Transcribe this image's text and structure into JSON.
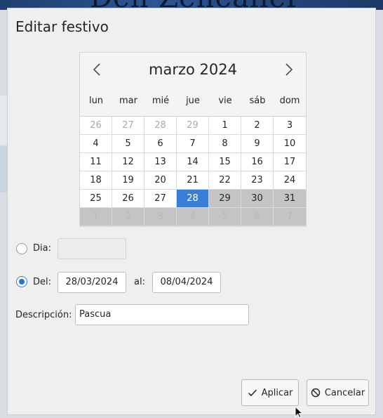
{
  "dialog": {
    "title": "Editar festivo"
  },
  "calendar": {
    "month_label": "marzo 2024",
    "weekdays": [
      "lun",
      "mar",
      "mié",
      "jue",
      "vie",
      "sáb",
      "dom"
    ],
    "weeks": [
      [
        {
          "d": "26",
          "s": "other"
        },
        {
          "d": "27",
          "s": "other"
        },
        {
          "d": "28",
          "s": "other"
        },
        {
          "d": "29",
          "s": "other"
        },
        {
          "d": "1",
          "s": ""
        },
        {
          "d": "2",
          "s": ""
        },
        {
          "d": "3",
          "s": ""
        }
      ],
      [
        {
          "d": "4",
          "s": ""
        },
        {
          "d": "5",
          "s": ""
        },
        {
          "d": "6",
          "s": ""
        },
        {
          "d": "7",
          "s": ""
        },
        {
          "d": "8",
          "s": ""
        },
        {
          "d": "9",
          "s": ""
        },
        {
          "d": "10",
          "s": ""
        }
      ],
      [
        {
          "d": "11",
          "s": ""
        },
        {
          "d": "12",
          "s": ""
        },
        {
          "d": "13",
          "s": ""
        },
        {
          "d": "14",
          "s": ""
        },
        {
          "d": "15",
          "s": ""
        },
        {
          "d": "16",
          "s": ""
        },
        {
          "d": "17",
          "s": ""
        }
      ],
      [
        {
          "d": "18",
          "s": ""
        },
        {
          "d": "19",
          "s": ""
        },
        {
          "d": "20",
          "s": ""
        },
        {
          "d": "21",
          "s": ""
        },
        {
          "d": "22",
          "s": ""
        },
        {
          "d": "23",
          "s": ""
        },
        {
          "d": "24",
          "s": ""
        }
      ],
      [
        {
          "d": "25",
          "s": ""
        },
        {
          "d": "26",
          "s": ""
        },
        {
          "d": "27",
          "s": ""
        },
        {
          "d": "28",
          "s": "sel"
        },
        {
          "d": "29",
          "s": "range"
        },
        {
          "d": "30",
          "s": "range"
        },
        {
          "d": "31",
          "s": "range"
        }
      ],
      [
        {
          "d": "1",
          "s": "hidden"
        },
        {
          "d": "2",
          "s": "hidden"
        },
        {
          "d": "3",
          "s": "hidden"
        },
        {
          "d": "4",
          "s": "hidden"
        },
        {
          "d": "5",
          "s": "hidden"
        },
        {
          "d": "6",
          "s": "hidden"
        },
        {
          "d": "7",
          "s": "hidden"
        }
      ]
    ],
    "colors": {
      "selected": "#3a7fd5",
      "range": "#c4c4c4"
    }
  },
  "form": {
    "dia_label": "Dia:",
    "dia_value": "",
    "del_label": "Del:",
    "del_value": "28/03/2024",
    "al_label": "al:",
    "al_value": "08/04/2024",
    "desc_label": "Descripción:",
    "desc_value": "Pascua",
    "selected_mode": "del"
  },
  "buttons": {
    "apply_label": "Aplicar",
    "cancel_label": "Cancelar"
  },
  "icons": {
    "prev": "chevron-left-icon",
    "next": "chevron-right-icon",
    "apply": "check-icon",
    "cancel": "cancel-icon"
  }
}
